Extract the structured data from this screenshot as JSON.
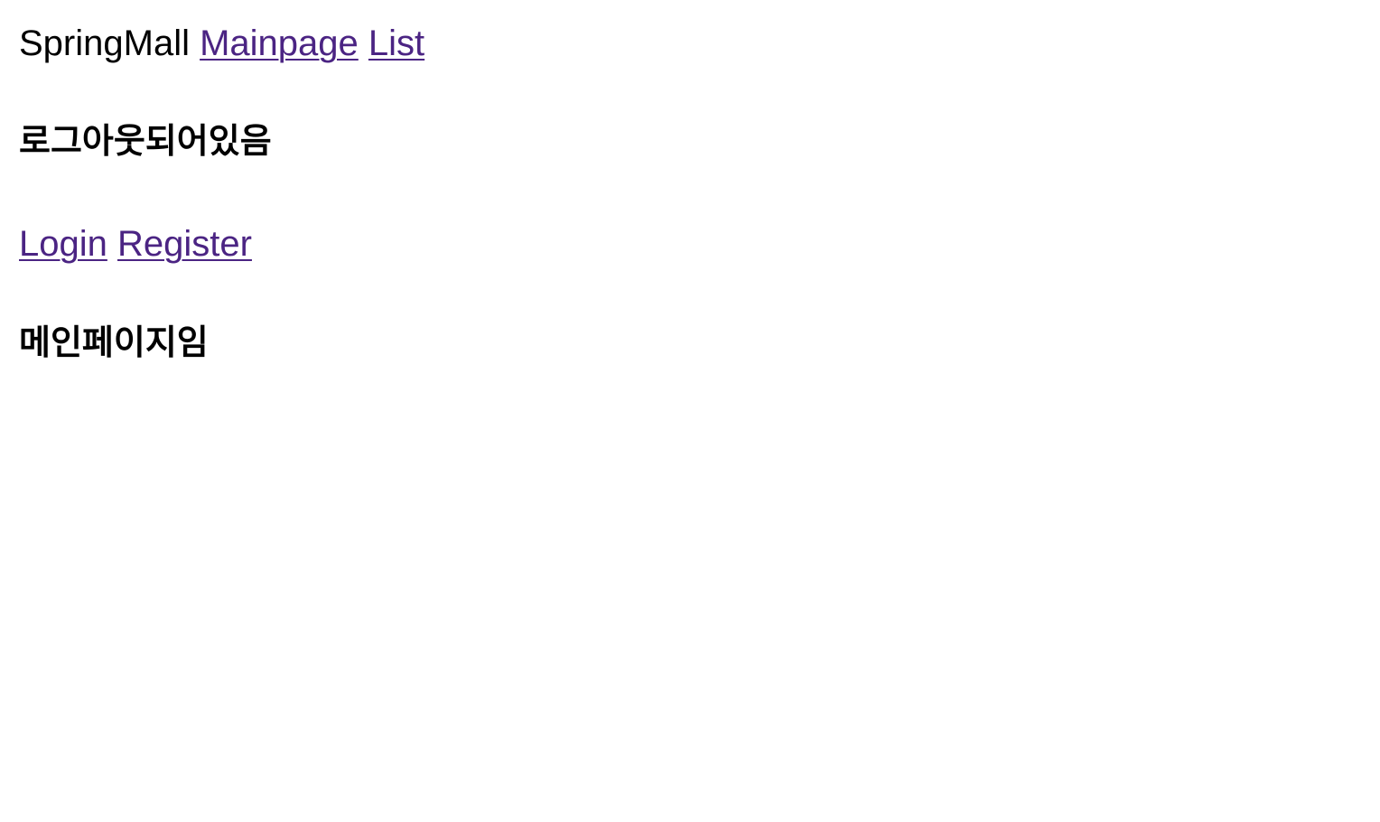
{
  "nav": {
    "brand": "SpringMall",
    "links": [
      {
        "label": "Mainpage"
      },
      {
        "label": "List"
      }
    ]
  },
  "status": {
    "text": "로그아웃되어있음"
  },
  "auth": {
    "login_label": "Login",
    "register_label": "Register"
  },
  "main": {
    "heading": "메인페이지임"
  },
  "colors": {
    "link": "#4b2483",
    "text": "#000000",
    "background": "#ffffff"
  }
}
